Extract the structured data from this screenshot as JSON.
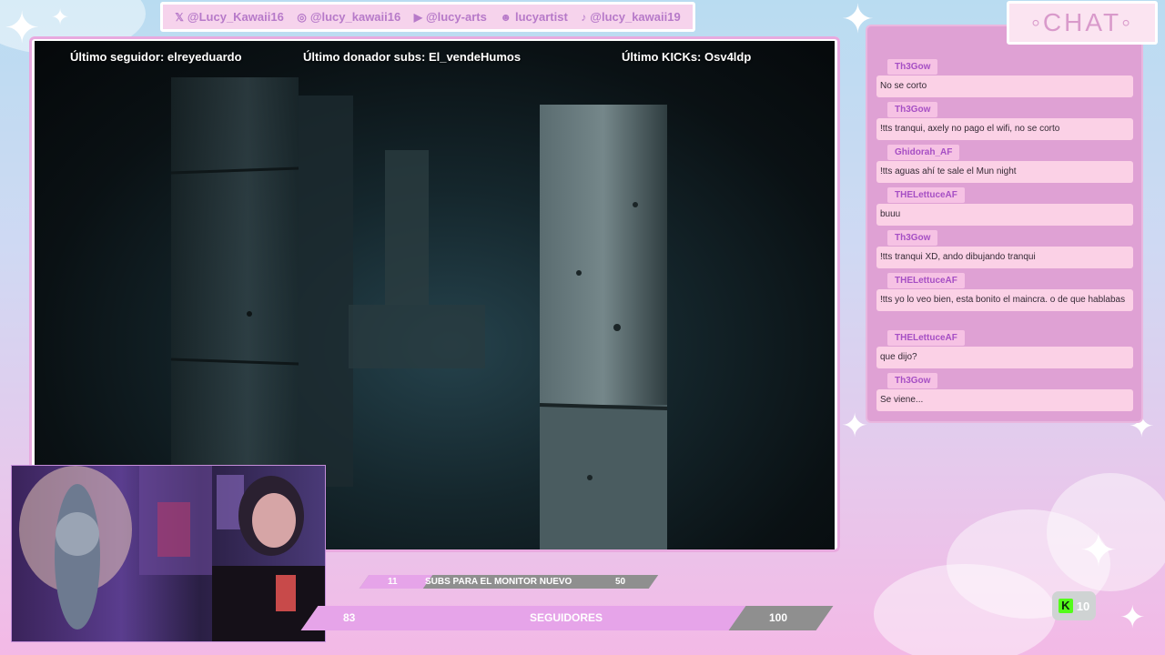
{
  "social": [
    {
      "icon": "x-icon",
      "glyph": "𝕏",
      "handle": "@Lucy_Kawaii16"
    },
    {
      "icon": "instagram-icon",
      "glyph": "◎",
      "handle": "@lucy_kawaii16"
    },
    {
      "icon": "youtube-icon",
      "glyph": "▶",
      "handle": "@lucy-arts"
    },
    {
      "icon": "discord-icon",
      "glyph": "☻",
      "handle": "lucyartist"
    },
    {
      "icon": "tiktok-icon",
      "glyph": "♪",
      "handle": "@lucy_kawaii19"
    }
  ],
  "hud": {
    "last_follower": "Último seguidor: elreyeduardo",
    "last_donor": "Último donador subs: El_vendeHumos",
    "last_kicks": "Último KICKs: Osv4ldp"
  },
  "chat": {
    "title": "◦CHAT◦",
    "messages": [
      {
        "user": "Th3Gow",
        "text": "No se corto"
      },
      {
        "user": "Th3Gow",
        "text": "!tts tranqui, axely no pago el wifi, no se corto"
      },
      {
        "user": "Ghidorah_AF",
        "text": "!tts aguas ahí te sale el Mun night"
      },
      {
        "user": "THELettuceAF",
        "text": "buuu"
      },
      {
        "user": "Th3Gow",
        "text": "!tts tranqui XD, ando dibujando tranqui"
      },
      {
        "user": "THELettuceAF",
        "text": "!tts yo lo veo bien, esta bonito el maincra. o de que hablabas"
      },
      {
        "user": "THELettuceAF",
        "text": "que dijo?"
      },
      {
        "user": "Th3Gow",
        "text": "Se viene..."
      }
    ]
  },
  "goals": {
    "subs": {
      "current": "11",
      "label": "SUBS PARA EL MONITOR NUEVO",
      "target": "50",
      "progress": 0.22
    },
    "followers": {
      "current": "83",
      "label": "SEGUIDORES",
      "target": "100",
      "progress": 0.83
    }
  },
  "viewers": {
    "count": "10",
    "logo": "K"
  },
  "colors": {
    "accent": "#e6a4e9",
    "chat_panel": "#dfa1d4",
    "chat_bubble": "#fbd1e6",
    "username": "#a64fc4"
  }
}
